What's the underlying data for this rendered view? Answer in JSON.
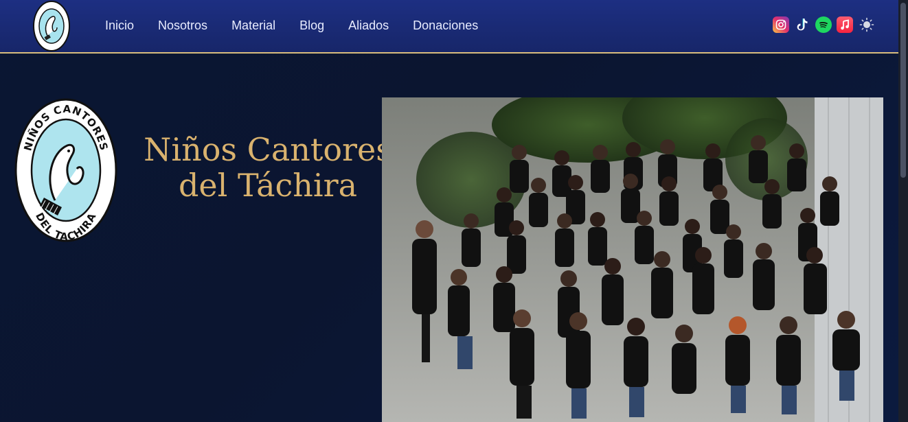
{
  "navbar": {
    "logo_alt": "Niños Cantores del Táchira",
    "links": [
      "Inicio",
      "Nosotros",
      "Material",
      "Blog",
      "Aliados",
      "Donaciones"
    ],
    "social": [
      "instagram-icon",
      "tiktok-icon",
      "spotify-icon",
      "apple-music-icon",
      "theme-toggle-icon"
    ]
  },
  "hero": {
    "title_line1": "Niños Cantores",
    "title_line2": "del Táchira",
    "logo_top": "NIÑOS CANTORES",
    "logo_bottom": "DEL TACHIRA"
  },
  "colors": {
    "nav_bg": "#1d2f82",
    "accent_gold": "#d9b26e",
    "page_bg": "#0b1530"
  }
}
